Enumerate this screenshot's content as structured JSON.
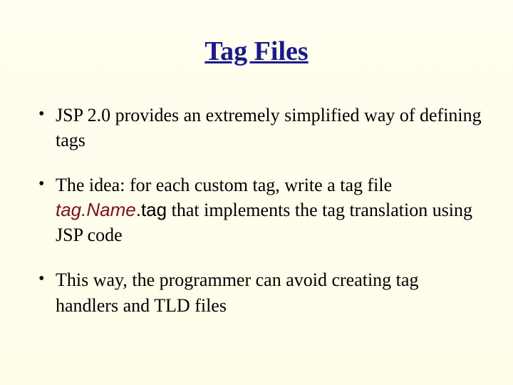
{
  "title": "Tag Files",
  "bullets": {
    "b1": "JSP 2.0 provides an extremely simplified way of defining tags",
    "b2_pre": "The idea: for each custom tag, write a tag file ",
    "b2_tagname": "tag.Name",
    "b2_tagext": ".tag",
    "b2_post": " that implements the tag translation using JSP code",
    "b3": "This way, the programmer can avoid creating tag handlers and TLD files"
  }
}
